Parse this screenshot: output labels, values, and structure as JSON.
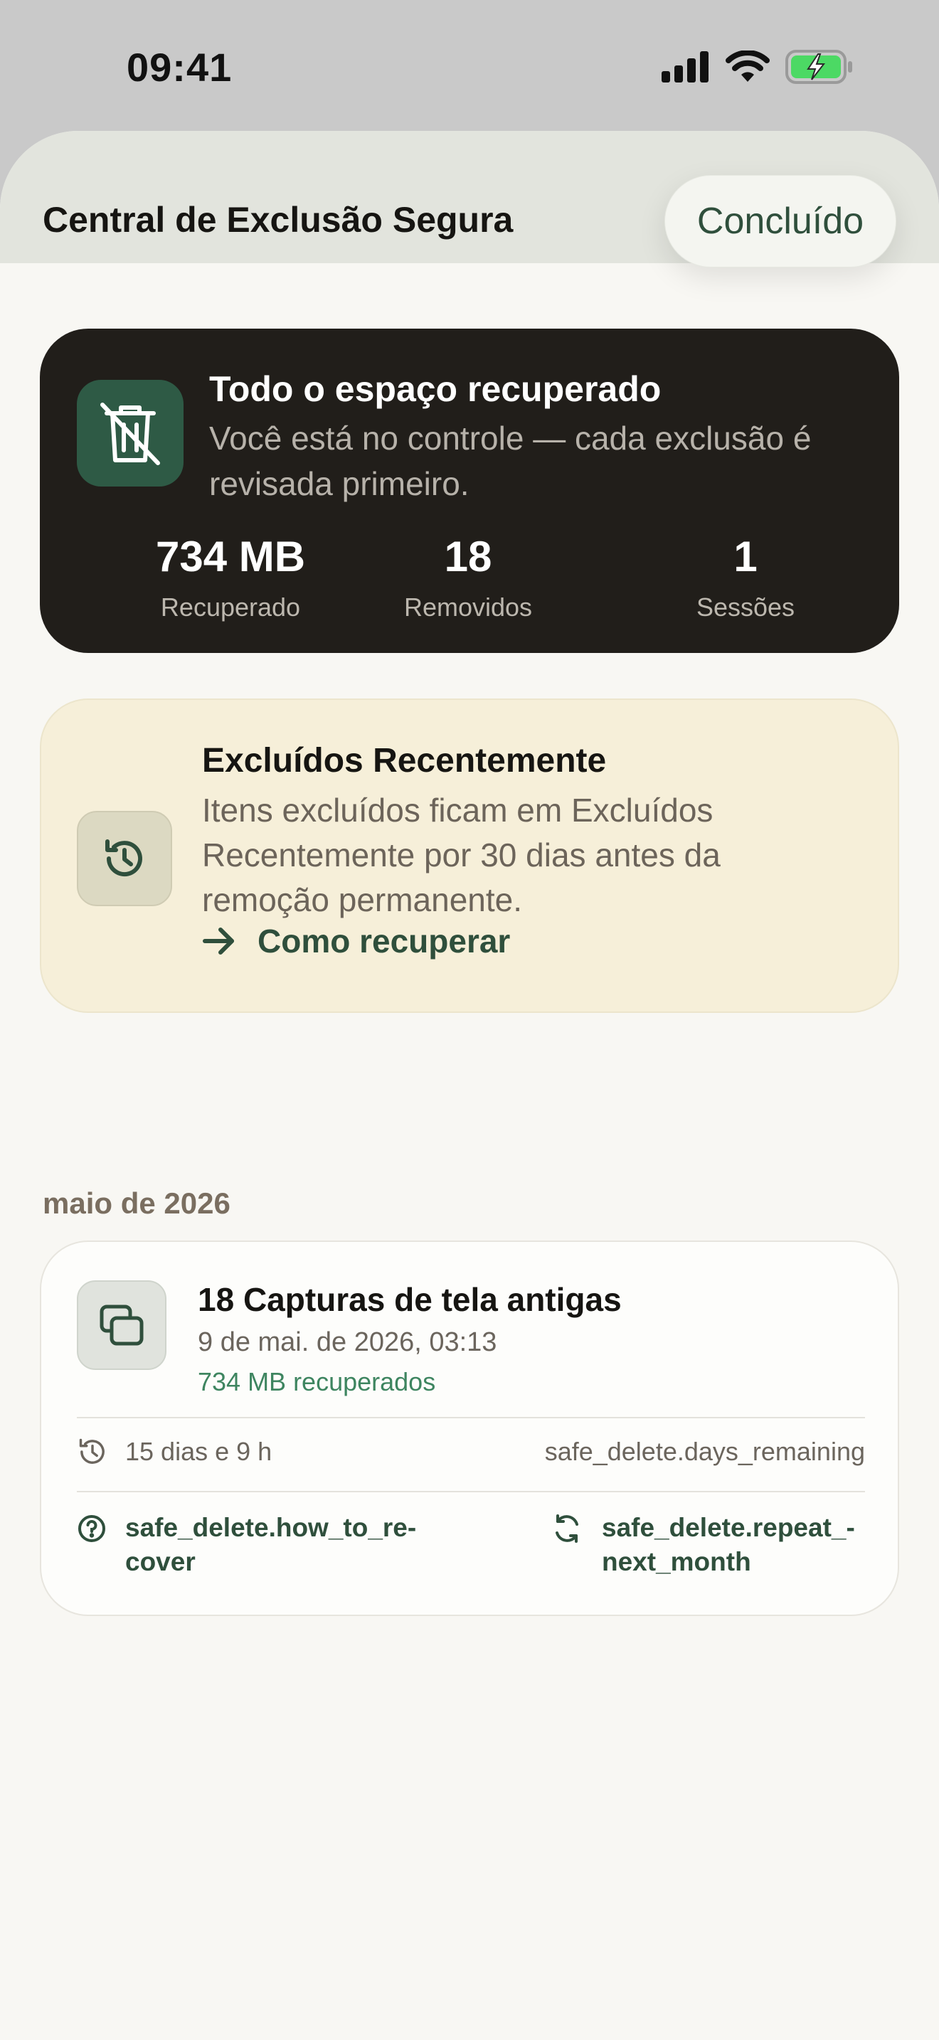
{
  "status_bar": {
    "time": "09:41",
    "icons": [
      "cellular-signal-icon",
      "wifi-icon",
      "battery-charging-icon"
    ]
  },
  "header": {
    "title": "Central de Exclusão Segura",
    "done_label": "Concluído"
  },
  "summary": {
    "icon": "trash-crossed-icon",
    "title": "Todo o espaço recuperado",
    "subtitle": "Você está no controle — cada exclusão é revisada primeiro.",
    "stats": [
      {
        "value": "734 MB",
        "label": "Recuperado"
      },
      {
        "value": "18",
        "label": "Removidos"
      },
      {
        "value": "1",
        "label": "Sessões"
      }
    ]
  },
  "recently_deleted": {
    "icon": "history-icon",
    "title": "Excluídos Recentemente",
    "body": "Itens excluídos ficam em Excluídos Recentemente por 30 dias antes da remoção permanente.",
    "link_label": "Como recuperar"
  },
  "sessions": {
    "section_title": "maio de 2026",
    "items": [
      {
        "icon": "screenshots-icon",
        "title": "18 Capturas de tela antigas",
        "date": "9 de mai. de 2026, 03:13",
        "recovered": "734 MB recuperados",
        "remaining": "15 dias e 9 h",
        "remaining_key": "safe_delete.days_remaining",
        "action_recover": "safe_delete.how_to_re-cover",
        "action_recover_lines": [
          "safe_delete.how_to_re-",
          "cover"
        ],
        "action_repeat": "safe_delete.repeat_-next_month",
        "action_repeat_lines": [
          "safe_delete.repeat_-",
          "next_month"
        ]
      }
    ]
  },
  "colors": {
    "accent": "#2f4f3c",
    "summary_bg": "#211e1a",
    "info_bg": "#f6efd9",
    "success": "#3e8560",
    "battery": "#4cd964"
  }
}
